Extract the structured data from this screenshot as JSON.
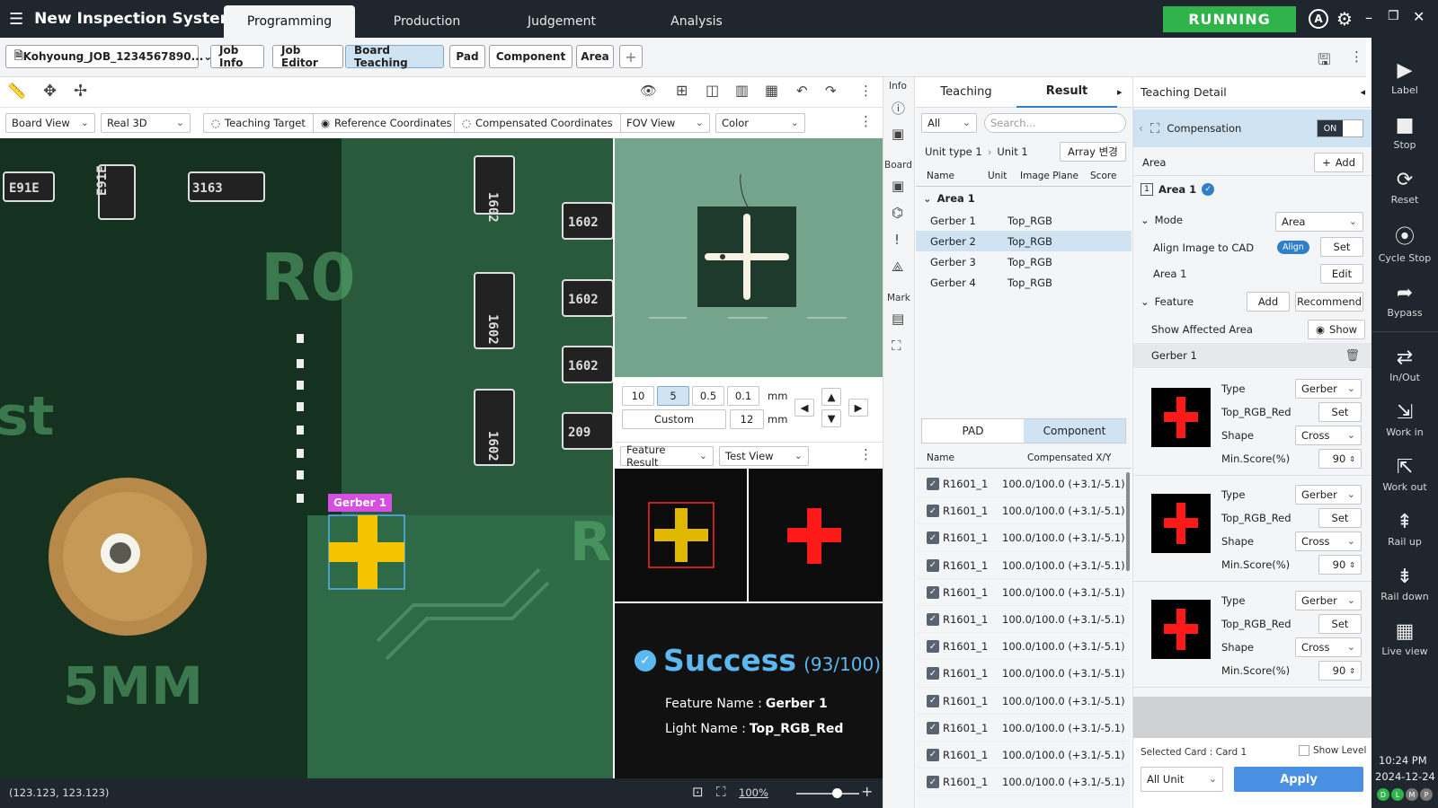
{
  "app": {
    "title": "New Inspection System",
    "status": "RUNNING",
    "user_initial": "A"
  },
  "top_tabs": [
    "Programming",
    "Production",
    "Judgement",
    "Analysis"
  ],
  "toolbar": {
    "job_name": "Kohyoung_JOB_1234567890...",
    "tabs": [
      "Job Info",
      "Job Editor",
      "Board Teaching",
      "Pad",
      "Component",
      "Area"
    ],
    "add": "+"
  },
  "view_toolbar": {
    "board_view": "Board View",
    "real3d": "Real 3D",
    "teaching_target": "Teaching Target",
    "reference_coords": "Reference Coordinates",
    "compensated_coords": "Compensated Coordinates",
    "fov_view": "FOV View",
    "color": "Color"
  },
  "image": {
    "marker_label": "Gerber 1",
    "chip_labels": [
      "E91E",
      "E91E",
      "3163",
      "1602",
      "1602",
      "1602",
      "1602",
      "1602",
      "1602",
      "209"
    ],
    "silk": [
      "R0",
      "st",
      "R",
      "5MM"
    ],
    "coords": "(123.123, 123.123)",
    "zoom": "100%"
  },
  "fov": {
    "steps": [
      "10",
      "5",
      "0.5",
      "0.1"
    ],
    "unit": "mm",
    "active_step": "5",
    "custom_label": "Custom",
    "custom_value": "12",
    "custom_unit": "mm",
    "feature_result": "Feature Result",
    "test_view": "Test View"
  },
  "result": {
    "status": "Success",
    "score": "(93/100)",
    "feature_label": "Feature Name :",
    "feature_value": "Gerber 1",
    "light_label": "Light Name :",
    "light_value": "Top_RGB_Red"
  },
  "side_icons": {
    "info": "Info",
    "board": "Board",
    "mark": "Mark"
  },
  "teaching_panel": {
    "tabs": [
      "Teaching",
      "Result"
    ],
    "filter": "All",
    "search_placeholder": "Search...",
    "breadcrumb": [
      "Unit type 1",
      "Unit 1"
    ],
    "array_btn": "Array 변경",
    "columns": [
      "Name",
      "Unit",
      "Image Plane",
      "Score"
    ],
    "group": "Area 1",
    "rows": [
      {
        "name": "Gerber 1",
        "plane": "Top_RGB"
      },
      {
        "name": "Gerber 2",
        "plane": "Top_RGB"
      },
      {
        "name": "Gerber 3",
        "plane": "Top_RGB"
      },
      {
        "name": "Gerber 4",
        "plane": "Top_RGB"
      }
    ],
    "selected_row": 1,
    "sub_tabs": [
      "PAD",
      "Component"
    ],
    "comp_columns": [
      "Name",
      "Compensated X/Y"
    ],
    "comp_rows": [
      {
        "name": "R1601_1",
        "value": "100.0/100.0 (+3.1/-5.1)"
      },
      {
        "name": "R1601_1",
        "value": "100.0/100.0 (+3.1/-5.1)"
      },
      {
        "name": "R1601_1",
        "value": "100.0/100.0 (+3.1/-5.1)"
      },
      {
        "name": "R1601_1",
        "value": "100.0/100.0 (+3.1/-5.1)"
      },
      {
        "name": "R1601_1",
        "value": "100.0/100.0 (+3.1/-5.1)"
      },
      {
        "name": "R1601_1",
        "value": "100.0/100.0 (+3.1/-5.1)"
      },
      {
        "name": "R1601_1",
        "value": "100.0/100.0 (+3.1/-5.1)"
      },
      {
        "name": "R1601_1",
        "value": "100.0/100.0 (+3.1/-5.1)"
      },
      {
        "name": "R1601_1",
        "value": "100.0/100.0 (+3.1/-5.1)"
      },
      {
        "name": "R1601_1",
        "value": "100.0/100.0 (+3.1/-5.1)"
      },
      {
        "name": "R1601_1",
        "value": "100.0/100.0 (+3.1/-5.1)"
      },
      {
        "name": "R1601_1",
        "value": "100.0/100.0 (+3.1/-5.1)"
      }
    ]
  },
  "detail": {
    "title": "Teaching Detail",
    "compensation": "Compensation",
    "toggle": "ON",
    "area_label": "Area",
    "add": "Add",
    "area_index": "1",
    "area_name": "Area 1",
    "mode_label": "Mode",
    "mode_value": "Area",
    "align_label": "Align Image to CAD",
    "align_badge": "Align",
    "set": "Set",
    "area1": "Area 1",
    "edit": "Edit",
    "feature_label": "Feature",
    "feature_add": "Add",
    "recommend": "Recommend",
    "affected": "Show Affected Area",
    "show": "Show",
    "gerber": "Gerber 1",
    "cards": [
      {
        "type_label": "Type",
        "type": "Gerber",
        "light": "Top_RGB_Red",
        "set": "Set",
        "shape_label": "Shape",
        "shape": "Cross",
        "score_label": "Min.Score(%)",
        "score": "90"
      },
      {
        "type_label": "Type",
        "type": "Gerber",
        "light": "Top_RGB_Red",
        "set": "Set",
        "shape_label": "Shape",
        "shape": "Cross",
        "score_label": "Min.Score(%)",
        "score": "90"
      },
      {
        "type_label": "Type",
        "type": "Gerber",
        "light": "Top_RGB_Red",
        "set": "Set",
        "shape_label": "Shape",
        "shape": "Cross",
        "score_label": "Min.Score(%)",
        "score": "90"
      }
    ],
    "selected_card": "Selected Card : Card 1",
    "show_level": "Show Level",
    "all_unit": "All Unit",
    "apply": "Apply"
  },
  "right_bar": {
    "items": [
      "Label",
      "Stop",
      "Reset",
      "Cycle Stop",
      "Bypass",
      "In/Out",
      "Work in",
      "Work out",
      "Rail up",
      "Rail down",
      "Live view"
    ],
    "time": "10:24 PM",
    "date": "2024-12-24",
    "indicators": [
      "D",
      "L",
      "M",
      "P"
    ]
  },
  "colors": {
    "accent": "#2f80c8",
    "running": "#2fb34a",
    "topbar": "#20262d",
    "marker": "#f5c400",
    "marker_label": "#d64fe0",
    "success": "#5cb8f0",
    "cross_red": "#ff1a1a"
  }
}
